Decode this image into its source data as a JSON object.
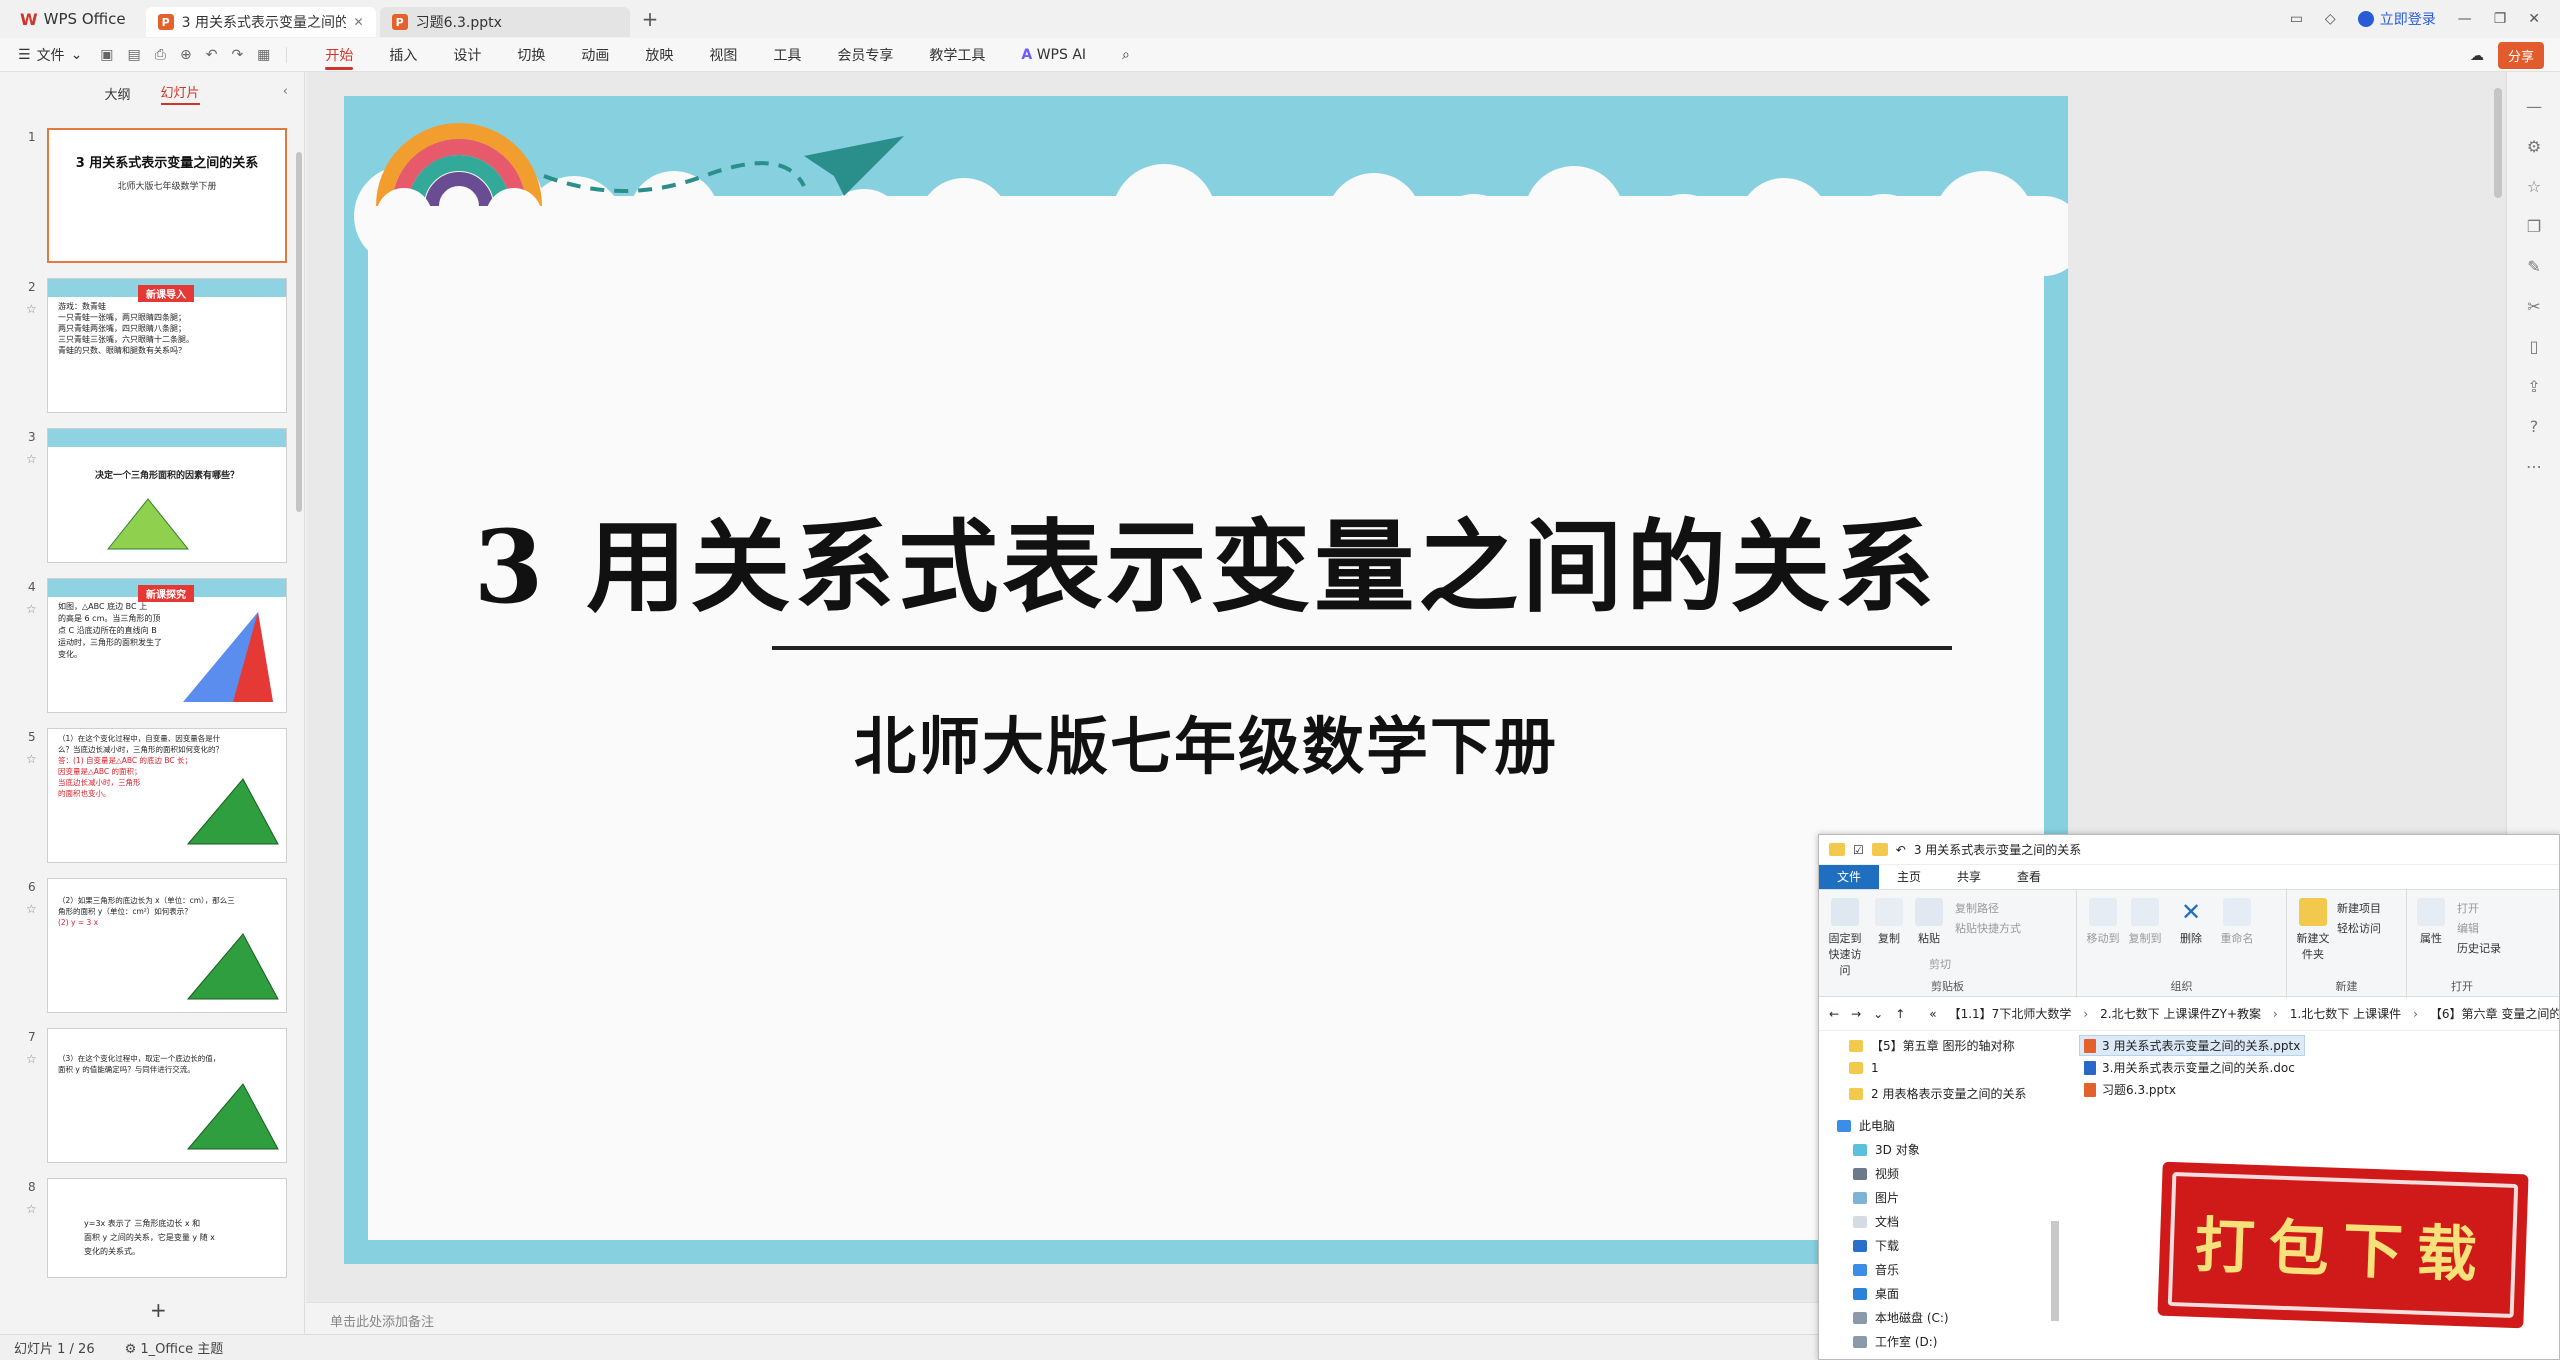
{
  "titlebar": {
    "app_name": "WPS Office",
    "tabs": [
      {
        "label": "3 用关系式表示变量之间的关系",
        "active": true
      },
      {
        "label": "习题6.3.pptx",
        "active": false
      }
    ],
    "login_label": "立即登录"
  },
  "menubar": {
    "file_label": "文件",
    "items": [
      "开始",
      "插入",
      "设计",
      "切换",
      "动画",
      "放映",
      "视图",
      "工具",
      "会员专享",
      "教学工具"
    ],
    "active_item": "开始",
    "ai_label": "WPS AI",
    "share_label": "分享"
  },
  "panel": {
    "tab_outline": "大纲",
    "tab_slides": "幻灯片",
    "slides": [
      {
        "num": "1",
        "title": "3 用关系式表示变量之间的关系",
        "sub": "北师大版七年级数学下册"
      },
      {
        "num": "2",
        "tag": "新课导入",
        "lines": [
          "游戏：数青蛙",
          "一只青蛙一张嘴，两只眼睛四条腿；",
          "两只青蛙两张嘴，四只眼睛八条腿；",
          "三只青蛙三张嘴，六只眼睛十二条腿。",
          "青蛙的只数、眼睛和腿数有关系吗？"
        ]
      },
      {
        "num": "3",
        "lines": [
          "决定一个三角形面积的因素有哪些？"
        ]
      },
      {
        "num": "4",
        "tag": "新课探究",
        "lines": [
          "如图，△ABC 底边 BC 上",
          "的高是 6 cm。当三角形的顶",
          "点 C 沿底边所在的直线向 B",
          "运动时，三角形的面积发生了",
          "变化。"
        ]
      },
      {
        "num": "5",
        "lines": [
          "（1）在这个变化过程中，自变量、因变量各是什",
          "么？当底边长减小时，三角形的面积如何变化的？",
          "答：(1) 自变量是△ABC 的底边 BC 长；",
          "因变量是△ABC 的面积；",
          "当底边长减小时，三角形",
          "的面积也变小。"
        ]
      },
      {
        "num": "6",
        "lines": [
          "（2）如果三角形的底边长为 x（单位：cm），那么三",
          "角形的面积 y（单位：cm²）如何表示？",
          "(2) y = 3 x"
        ]
      },
      {
        "num": "7",
        "lines": [
          "（3）在这个变化过程中，取定一个底边长的值，",
          "面积 y 的值能确定吗？与同伴进行交流。"
        ]
      },
      {
        "num": "8",
        "lines": [
          "y=3x 表示了 三角形底边长 x 和",
          "面积 y 之间的关系，它是变量 y 随 x",
          "变化的关系式。"
        ]
      }
    ],
    "add_label": "+"
  },
  "slide": {
    "title": "3 用关系式表示变量之间的关系",
    "subtitle": "北师大版七年级数学下册"
  },
  "notes": {
    "placeholder": "单击此处添加备注"
  },
  "status": {
    "slide_counter": "幻灯片 1 / 26",
    "theme": "1_Office 主题"
  },
  "explorer": {
    "title": "3 用关系式表示变量之间的关系",
    "tabs": [
      "文件",
      "主页",
      "共享",
      "查看"
    ],
    "ribbon": {
      "pin": "固定到快速访问",
      "copy": "复制",
      "paste": "粘贴",
      "copy_path": "复制路径",
      "paste_shortcut": "粘贴快捷方式",
      "cut": "剪切",
      "clipboard": "剪贴板",
      "move_to": "移动到",
      "copy_to": "复制到",
      "delete": "删除",
      "rename": "重命名",
      "organize": "组织",
      "new_folder": "新建文件夹",
      "new_item": "新建项目",
      "easy_access": "轻松访问",
      "new": "新建",
      "properties": "属性",
      "open": "打开",
      "edit": "编辑",
      "history": "历史记录",
      "open_group": "打开"
    },
    "address": [
      "«",
      "【1.1】7下北师大数学",
      "2.北七数下 上课课件ZY+教案",
      "1.北七数下 上课课件",
      "【6】第六章 变量之间的"
    ],
    "nav_items": [
      "【5】第五章 图形的轴对称",
      "1",
      "2 用表格表示变量之间的关系",
      "此电脑",
      "3D 对象",
      "视频",
      "图片",
      "文档",
      "下载",
      "音乐",
      "桌面",
      "本地磁盘 (C:)",
      "工作室 (D:)"
    ],
    "files": [
      "3 用关系式表示变量之间的关系.pptx",
      "3.用关系式表示变量之间的关系.doc",
      "习题6.3.pptx"
    ]
  },
  "stamp": {
    "text": "打包下载"
  },
  "colors": {
    "accent": "#d0352b",
    "slide_border": "#86d0e0",
    "stamp": "#d01a1a",
    "stamp_text": "#f8e17a"
  }
}
